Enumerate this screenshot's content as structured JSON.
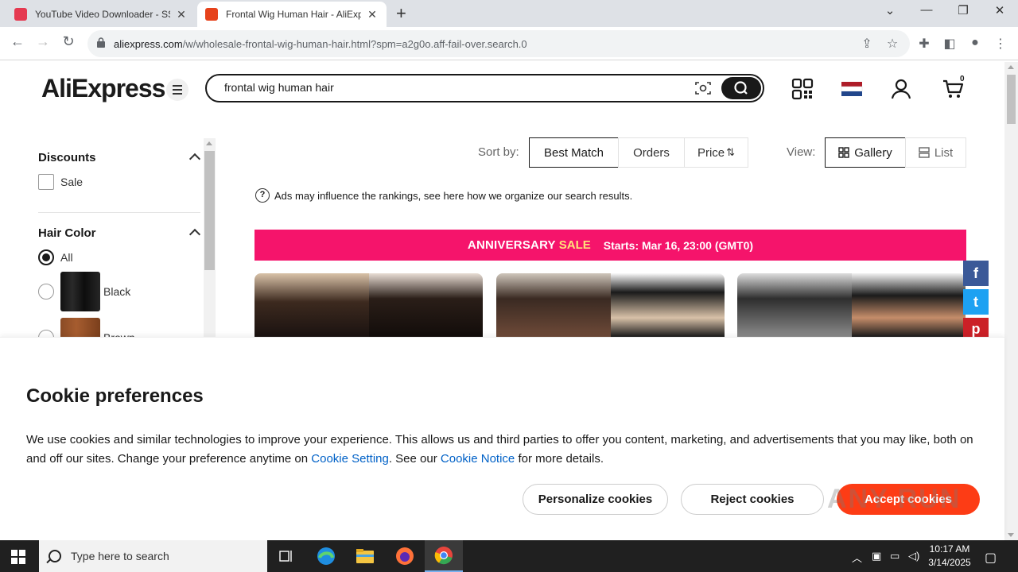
{
  "browser": {
    "tabs": [
      {
        "title": "YouTube Video Downloader - SSY",
        "close": "✕"
      },
      {
        "title": "Frontal Wig Human Hair - AliExp",
        "close": "✕"
      }
    ],
    "new_tab": "+",
    "window_controls": {
      "dropdown": "⌄",
      "minimize": "—",
      "restore": "❐",
      "close": "✕"
    },
    "url_domain": "aliexpress.com",
    "url_path": "/w/wholesale-frontal-wig-human-hair.html?spm=a2g0o.aff-fail-over.search.0"
  },
  "header": {
    "logo": "AliExpress",
    "search_value": "frontal wig human hair",
    "cart_count": "0"
  },
  "sidebar": {
    "discounts_title": "Discounts",
    "sale_label": "Sale",
    "hair_color_title": "Hair Color",
    "colors": [
      "All",
      "Black",
      "Brown"
    ]
  },
  "sort": {
    "label": "Sort by:",
    "options": [
      "Best Match",
      "Orders",
      "Price"
    ],
    "price_arrows": "⇅",
    "view_label": "View:",
    "gallery": "Gallery",
    "list": "List"
  },
  "ads_notice": "Ads may influence the rankings, see here how we organize our search results.",
  "banner": {
    "anniversary": "ANNIVERSARY",
    "sale": "SALE",
    "starts": "Starts:  Mar 16, 23:00 (GMT0)",
    "color": "#f5146b"
  },
  "social": [
    "f",
    "t",
    "p"
  ],
  "cookie": {
    "title": "Cookie preferences",
    "text_1": "We use cookies and similar technologies to improve your experience. This allows us and third parties to offer you content, marketing, and advertisements that you may like, both on and off our sites. Change your preference anytime on ",
    "link_setting": "Cookie Setting",
    "text_2": ". See our ",
    "link_notice": "Cookie Notice",
    "text_3": " for more details.",
    "personalize": "Personalize cookies",
    "reject": "Reject cookies",
    "accept": "Accept cookies",
    "accept_color": "#fd3c15"
  },
  "watermark": "ANY RUN",
  "taskbar": {
    "search_placeholder": "Type here to search",
    "time": "10:17 AM",
    "date": "3/14/2025"
  }
}
